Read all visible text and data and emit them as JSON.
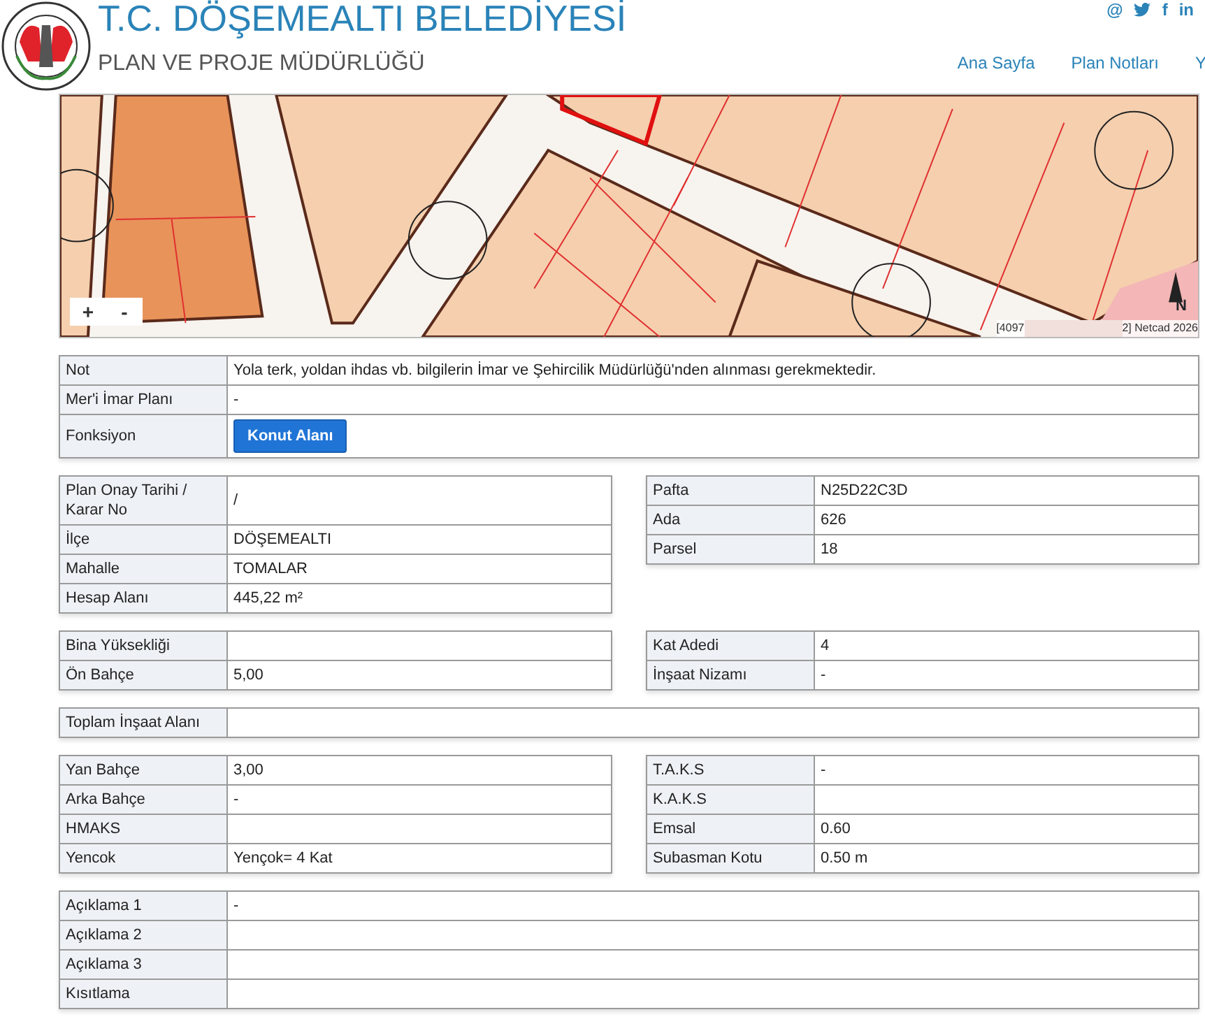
{
  "header": {
    "title": "T.C. DÖŞEMEALTI BELEDİYESİ",
    "subtitle": "PLAN VE PROJE MÜDÜRLÜĞÜ",
    "social": [
      {
        "kind": "glyph",
        "label": "@"
      },
      {
        "kind": "bird"
      },
      {
        "kind": "glyph",
        "label": "f"
      },
      {
        "kind": "glyph",
        "label": "in"
      }
    ],
    "nav": [
      "Ana Sayfa",
      "Plan Notları",
      "Y"
    ]
  },
  "map": {
    "zoom_in": "+",
    "zoom_out": "-",
    "north_label": "N",
    "attribution": [
      "[4097",
      "2] Netcad 2026"
    ]
  },
  "sections": [
    {
      "kind": "full",
      "rows": [
        {
          "label": "Not",
          "kind": "text",
          "value": "Yola terk, yoldan ihdas vb. bilgilerin İmar ve Şehircilik Müdürlüğü'nden alınması gerekmektedir."
        },
        {
          "label": "Mer'i İmar Planı",
          "kind": "text",
          "value": "-"
        },
        {
          "label": "Fonksiyon",
          "kind": "button",
          "value": "Konut Alanı"
        }
      ]
    },
    {
      "kind": "pair",
      "left": [
        {
          "label": "Plan Onay Tarihi / Karar No",
          "value": "/"
        },
        {
          "label": "İlçe",
          "value": "DÖŞEMEALTI"
        },
        {
          "label": "Mahalle",
          "value": "TOMALAR"
        },
        {
          "label": "Hesap Alanı",
          "value": "445,22 m²"
        }
      ],
      "right": [
        {
          "label": "Pafta",
          "value": "N25D22C3D"
        },
        {
          "label": "Ada",
          "value": "626"
        },
        {
          "label": "Parsel",
          "value": "18"
        }
      ]
    },
    {
      "kind": "pair",
      "left": [
        {
          "label": "Bina Yüksekliği"
        },
        {
          "label": "Ön Bahçe",
          "value": "5,00"
        }
      ],
      "right": [
        {
          "label": "Kat Adedi",
          "value": "4"
        },
        {
          "label": "İnşaat Nizamı",
          "value": "-"
        }
      ]
    },
    {
      "kind": "full",
      "rows": [
        {
          "label": "Toplam İnşaat Alanı"
        }
      ]
    },
    {
      "kind": "pair",
      "left": [
        {
          "label": "Yan Bahçe",
          "value": "3,00"
        },
        {
          "label": "Arka Bahçe",
          "value": "-"
        },
        {
          "label": "HMAKS"
        },
        {
          "label": "Yencok",
          "value": "Yençok= 4 Kat"
        }
      ],
      "right": [
        {
          "label": "T.A.K.S",
          "value": "-"
        },
        {
          "label": "K.A.K.S"
        },
        {
          "label": "Emsal",
          "value": "0.60"
        },
        {
          "label": "Subasman Kotu",
          "value": "0.50 m"
        }
      ]
    },
    {
      "kind": "full",
      "rows": [
        {
          "label": "Açıklama 1",
          "value": "-"
        },
        {
          "label": "Açıklama 2"
        },
        {
          "label": "Açıklama 3"
        },
        {
          "label": "Kısıtlama"
        }
      ]
    }
  ]
}
